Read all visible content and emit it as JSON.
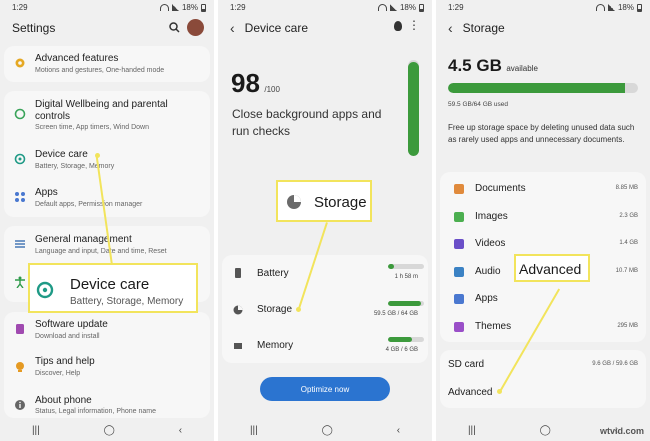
{
  "status": {
    "time": "1:29",
    "battery": "18%"
  },
  "screen1": {
    "title": "Settings",
    "items": [
      {
        "title": "Advanced features",
        "subtitle": "Motions and gestures, One-handed mode"
      },
      {
        "title": "Digital Wellbeing and parental controls",
        "subtitle": "Screen time, App timers, Wind Down"
      },
      {
        "title": "Device care",
        "subtitle": "Battery, Storage, Memory"
      },
      {
        "title": "Apps",
        "subtitle": "Default apps, Permission manager"
      },
      {
        "title": "General management",
        "subtitle": "Language and input, Date and time, Reset"
      },
      {
        "title": "Accessibility",
        "subtitle": ""
      },
      {
        "title": "Software update",
        "subtitle": "Download and install"
      },
      {
        "title": "Tips and help",
        "subtitle": "Discover, Help"
      },
      {
        "title": "About phone",
        "subtitle": "Status, Legal information, Phone name"
      }
    ],
    "callout": {
      "title": "Device care",
      "subtitle": "Battery, Storage, Memory"
    }
  },
  "screen2": {
    "title": "Device care",
    "score": "98",
    "score_max": "/100",
    "message": "Close background apps and run checks",
    "score_level": 0.98,
    "callout": "Storage",
    "items": [
      {
        "label": "Battery",
        "value": "1 h 58 m",
        "level": 0.18
      },
      {
        "label": "Storage",
        "value": "59.5 GB / 64 GB",
        "level": 0.93
      },
      {
        "label": "Memory",
        "value": "4 GB / 6 GB",
        "level": 0.67
      }
    ],
    "button": "Optimize now"
  },
  "screen3": {
    "title": "Storage",
    "available": "4.5 GB",
    "available_label": "available",
    "used": "59.5 GB/64 GB used",
    "used_level": 0.93,
    "description": "Free up storage space by deleting unused data such as rarely used apps and unnecessary documents.",
    "categories": [
      {
        "label": "Documents",
        "size": "8.85 MB",
        "color": "#e08a3c"
      },
      {
        "label": "Images",
        "size": "2.3 GB",
        "color": "#4caf50"
      },
      {
        "label": "Videos",
        "size": "1.4 GB",
        "color": "#6a4fc8"
      },
      {
        "label": "Audio",
        "size": "10.7 MB",
        "color": "#3b82c4"
      },
      {
        "label": "Apps",
        "size": "",
        "color": "#4a78d0"
      },
      {
        "label": "Themes",
        "size": "295 MB",
        "color": "#9a4fc8"
      }
    ],
    "sd_card": {
      "label": "SD card",
      "size": "9.6 GB / 59.6 GB"
    },
    "advanced": "Advanced",
    "callout": "Advanced"
  },
  "watermark": "wtvid.com"
}
